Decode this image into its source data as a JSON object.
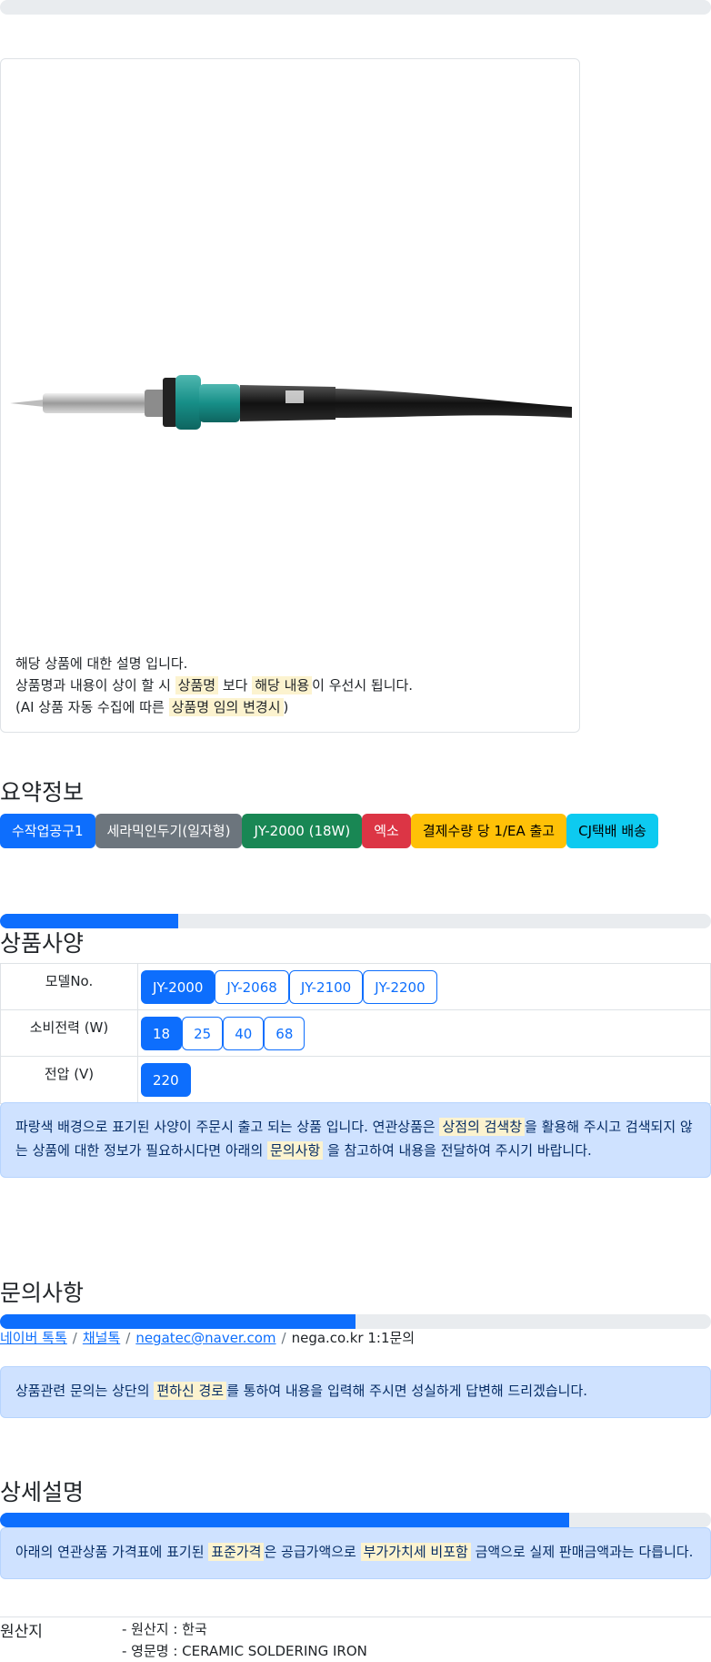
{
  "product": {
    "description_lines": [
      {
        "parts": [
          {
            "t": "해당 상품에 대한 설명 입니다.",
            "m": false
          }
        ]
      },
      {
        "parts": [
          {
            "t": "상품명과 내용이 상이 할 시 ",
            "m": false
          },
          {
            "t": "상품명",
            "m": true
          },
          {
            "t": " 보다 ",
            "m": false
          },
          {
            "t": "해당 내용",
            "m": true
          },
          {
            "t": "이 우선시 됩니다.",
            "m": false
          }
        ]
      },
      {
        "parts": [
          {
            "t": "(AI 상품 자동 수집에 따른 ",
            "m": false
          },
          {
            "t": "상품명 임의 변경시",
            "m": true
          },
          {
            "t": ")",
            "m": false
          }
        ]
      }
    ]
  },
  "summary": {
    "title": "요약정보",
    "badges": [
      {
        "label": "수작업공구1",
        "bg": "#0d6efd",
        "fg": "#ffffff"
      },
      {
        "label": "세라믹인두기(일자형)",
        "bg": "#6c757d",
        "fg": "#ffffff"
      },
      {
        "label": "JY-2000 (18W)",
        "bg": "#198754",
        "fg": "#ffffff"
      },
      {
        "label": "엑소",
        "bg": "#dc3545",
        "fg": "#ffffff"
      },
      {
        "label": "결제수량 당 1/EA 출고",
        "bg": "#ffc107",
        "fg": "#000000"
      },
      {
        "label": "CJ택배 배송",
        "bg": "#0dcaf0",
        "fg": "#000000"
      }
    ]
  },
  "spec": {
    "title": "상품사양",
    "progress_fraction": 0.25,
    "rows": [
      {
        "label": "모델No.",
        "options": [
          "JY-2000",
          "JY-2068",
          "JY-2100",
          "JY-2200"
        ],
        "selected": 0
      },
      {
        "label": "소비전력 (W)",
        "options": [
          "18",
          "25",
          "40",
          "68"
        ],
        "selected": 0
      },
      {
        "label": "전압 (V)",
        "options": [
          "220"
        ],
        "selected": 0
      }
    ],
    "notice": [
      {
        "t": "파랑색 배경으로 표기된 사양이 주문시 출고 되는 상품 입니다. 연관상품은 ",
        "m": false
      },
      {
        "t": "상점의 검색창",
        "m": true
      },
      {
        "t": "을 활용해 주시고 검색되지 않는 상품에 대한 정보가 필요하시다면 아래의 ",
        "m": false
      },
      {
        "t": "문의사항",
        "m": true
      },
      {
        "t": " 을 참고하여 내용을 전달하여 주시기 바랍니다.",
        "m": false
      }
    ]
  },
  "inquiry": {
    "title": "문의사항",
    "progress_fraction": 0.5,
    "links": [
      {
        "label": "네이버 톡톡",
        "link": true
      },
      {
        "label": "채널톡",
        "link": true
      },
      {
        "label": "negatec@naver.com",
        "link": true
      },
      {
        "label": "nega.co.kr 1:1문의",
        "link": false
      }
    ],
    "separator": "/",
    "notice": [
      {
        "t": "상품관련 문의는 상단의 ",
        "m": false
      },
      {
        "t": "편하신 경로",
        "m": true
      },
      {
        "t": "를 통하여 내용을 입력해 주시면 성실하게 답변해 드리겠습니다.",
        "m": false
      }
    ]
  },
  "detail": {
    "title": "상세설명",
    "progress_fraction": 0.8,
    "notice": [
      {
        "t": "아래의 연관상품 가격표에 표기된 ",
        "m": false
      },
      {
        "t": "표준가격",
        "m": true
      },
      {
        "t": "은 공급가액으로 ",
        "m": false
      },
      {
        "t": "부가가치세 비포함",
        "m": true
      },
      {
        "t": " 금액으로 실제 판매금액과는 다릅니다.",
        "m": false
      }
    ],
    "origin_label": "원산지",
    "origin_lines": [
      "- 원산지 : 한국",
      "- 영문명 : CERAMIC SOLDERING IRON"
    ]
  }
}
